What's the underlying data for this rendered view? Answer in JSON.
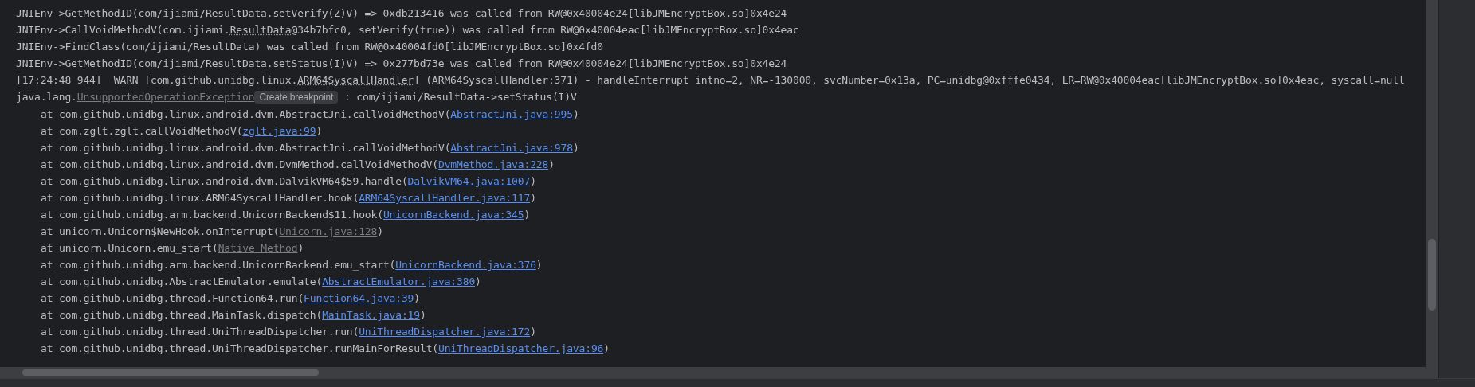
{
  "console": {
    "lines": [
      {
        "indent": false,
        "segments": [
          {
            "kind": "plain",
            "text": "JNIEnv->GetMethodID(com/ijiami/ResultData.setVerify(Z)V) => 0xdb213416 was called from RW@0x40004e24[libJMEncryptBox.so]0x4e24"
          }
        ]
      },
      {
        "indent": false,
        "segments": [
          {
            "kind": "plain",
            "text": "JNIEnv->CallVoidMethodV(com.ijiami."
          },
          {
            "kind": "dotted",
            "text": "ResultData"
          },
          {
            "kind": "plain",
            "text": "@34b7bfc0, setVerify(true)) was called from RW@0x40004eac[libJMEncryptBox.so]0x4eac"
          }
        ]
      },
      {
        "indent": false,
        "segments": [
          {
            "kind": "plain",
            "text": "JNIEnv->FindClass(com/ijiami/ResultData) was called from RW@0x40004fd0[libJMEncryptBox.so]0x4fd0"
          }
        ]
      },
      {
        "indent": false,
        "segments": [
          {
            "kind": "plain",
            "text": "JNIEnv->GetMethodID(com/ijiami/ResultData.setStatus(I)V) => 0x277bd73e was called from RW@0x40004e24[libJMEncryptBox.so]0x4e24"
          }
        ]
      },
      {
        "indent": false,
        "segments": [
          {
            "kind": "plain",
            "text": "[17:24:48 944]  WARN [com.github.unidbg.linux."
          },
          {
            "kind": "dotted",
            "text": "ARM64SyscallHandler"
          },
          {
            "kind": "plain",
            "text": "] (ARM64SyscallHandler:371) - handleInterrupt intno=2, NR=-130000, svcNumber=0x13a, PC=unidbg@0xfffe0434, LR=RW@0x40004eac[libJMEncryptBox.so]0x4eac, syscall=null"
          }
        ]
      },
      {
        "indent": false,
        "segments": [
          {
            "kind": "plain",
            "text": "java.lang."
          },
          {
            "kind": "muted-link",
            "text": "UnsupportedOperationException"
          },
          {
            "kind": "badge",
            "text": "Create breakpoint"
          },
          {
            "kind": "plain",
            "text": " : com/ijiami/ResultData->setStatus(I)V"
          }
        ]
      },
      {
        "indent": true,
        "segments": [
          {
            "kind": "plain",
            "text": "at com.github.unidbg.linux.android.dvm.AbstractJni.callVoidMethodV("
          },
          {
            "kind": "link",
            "text": "AbstractJni.java:995"
          },
          {
            "kind": "plain",
            "text": ")"
          }
        ]
      },
      {
        "indent": true,
        "segments": [
          {
            "kind": "plain",
            "text": "at com.zglt.zglt.callVoidMethodV("
          },
          {
            "kind": "link",
            "text": "zglt.java:99"
          },
          {
            "kind": "plain",
            "text": ")"
          }
        ]
      },
      {
        "indent": true,
        "segments": [
          {
            "kind": "plain",
            "text": "at com.github.unidbg.linux.android.dvm.AbstractJni.callVoidMethodV("
          },
          {
            "kind": "link",
            "text": "AbstractJni.java:978"
          },
          {
            "kind": "plain",
            "text": ")"
          }
        ]
      },
      {
        "indent": true,
        "segments": [
          {
            "kind": "plain",
            "text": "at com.github.unidbg.linux.android.dvm.DvmMethod.callVoidMethodV("
          },
          {
            "kind": "link",
            "text": "DvmMethod.java:228"
          },
          {
            "kind": "plain",
            "text": ")"
          }
        ]
      },
      {
        "indent": true,
        "segments": [
          {
            "kind": "plain",
            "text": "at com.github.unidbg.linux.android.dvm.DalvikVM64$59.handle("
          },
          {
            "kind": "link",
            "text": "DalvikVM64.java:1007"
          },
          {
            "kind": "plain",
            "text": ")"
          }
        ]
      },
      {
        "indent": true,
        "segments": [
          {
            "kind": "plain",
            "text": "at com.github.unidbg.linux.ARM64SyscallHandler.hook("
          },
          {
            "kind": "link",
            "text": "ARM64SyscallHandler.java:117"
          },
          {
            "kind": "plain",
            "text": ")"
          }
        ]
      },
      {
        "indent": true,
        "segments": [
          {
            "kind": "plain",
            "text": "at com.github.unidbg.arm.backend.UnicornBackend$11.hook("
          },
          {
            "kind": "link",
            "text": "UnicornBackend.java:345"
          },
          {
            "kind": "plain",
            "text": ")"
          }
        ]
      },
      {
        "indent": true,
        "segments": [
          {
            "kind": "plain",
            "text": "at unicorn.Unicorn$NewHook.onInterrupt("
          },
          {
            "kind": "muted-link",
            "text": "Unicorn.java:128"
          },
          {
            "kind": "plain",
            "text": ")"
          }
        ]
      },
      {
        "indent": true,
        "segments": [
          {
            "kind": "plain",
            "text": "at unicorn.Unicorn.emu_start("
          },
          {
            "kind": "muted-link",
            "text": "Native Method"
          },
          {
            "kind": "plain",
            "text": ")"
          }
        ]
      },
      {
        "indent": true,
        "segments": [
          {
            "kind": "plain",
            "text": "at com.github.unidbg.arm.backend.UnicornBackend.emu_start("
          },
          {
            "kind": "link",
            "text": "UnicornBackend.java:376"
          },
          {
            "kind": "plain",
            "text": ")"
          }
        ]
      },
      {
        "indent": true,
        "segments": [
          {
            "kind": "plain",
            "text": "at com.github.unidbg.AbstractEmulator.emulate("
          },
          {
            "kind": "link",
            "text": "AbstractEmulator.java:380"
          },
          {
            "kind": "plain",
            "text": ")"
          }
        ]
      },
      {
        "indent": true,
        "segments": [
          {
            "kind": "plain",
            "text": "at com.github.unidbg.thread.Function64.run("
          },
          {
            "kind": "link",
            "text": "Function64.java:39"
          },
          {
            "kind": "plain",
            "text": ")"
          }
        ]
      },
      {
        "indent": true,
        "segments": [
          {
            "kind": "plain",
            "text": "at com.github.unidbg.thread.MainTask.dispatch("
          },
          {
            "kind": "link",
            "text": "MainTask.java:19"
          },
          {
            "kind": "plain",
            "text": ")"
          }
        ]
      },
      {
        "indent": true,
        "segments": [
          {
            "kind": "plain",
            "text": "at com.github.unidbg.thread.UniThreadDispatcher.run("
          },
          {
            "kind": "link",
            "text": "UniThreadDispatcher.java:172"
          },
          {
            "kind": "plain",
            "text": ")"
          }
        ]
      },
      {
        "indent": true,
        "segments": [
          {
            "kind": "plain",
            "text": "at com.github.unidbg.thread.UniThreadDispatcher.runMainForResult("
          },
          {
            "kind": "link",
            "text": "UniThreadDispatcher.java:96"
          },
          {
            "kind": "plain",
            "text": ")"
          }
        ]
      }
    ]
  }
}
